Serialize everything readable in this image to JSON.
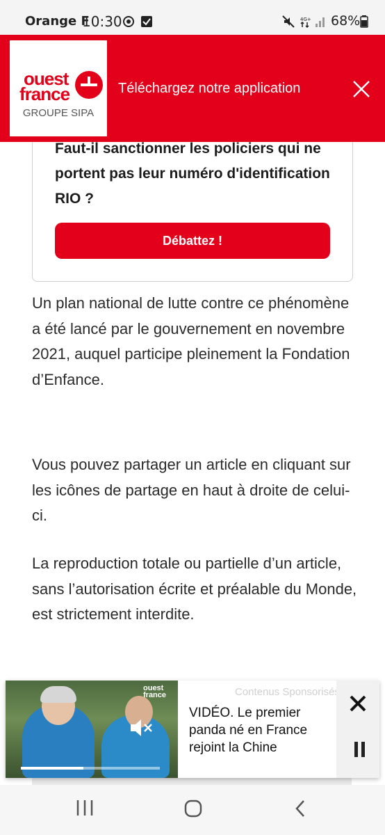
{
  "status_bar": {
    "carrier": "Orange F",
    "time": "10:30",
    "battery": "68%",
    "icons": [
      "notification-icon",
      "check-notification-icon",
      "mute-icon",
      "network-4g-icon",
      "signal-icon",
      "battery-icon"
    ]
  },
  "app_banner": {
    "logo_line1": "ouest",
    "logo_line2": "france",
    "logo_sub": "GROUPE SIPA",
    "text": "Téléchargez notre application",
    "close_icon": "close-icon",
    "color": "#e2001a"
  },
  "debate": {
    "question": "Faut-il sanctionner les policiers qui ne portent pas leur numéro d'identification RIO ?",
    "button_label": "Débattez !"
  },
  "article": {
    "paragraphs": [
      "Un plan national de lutte contre ce phénomène a été lancé par le gouvernement en novembre 2021, auquel participe pleinement la Fondation d’Enfance.",
      "Vous pouvez partager un article en cliquant sur les icônes de partage en haut à droite de celui-ci.",
      "La reproduction totale ou partielle d’un article, sans l’autorisation écrite et préalable du Monde, est strictement interdite."
    ]
  },
  "video_popup": {
    "label": "Contenus Sponsorisés",
    "title": "VIDÉO. Le premier panda né en France rejoint la Chine",
    "thumb_logo_line1": "ouest",
    "thumb_logo_line2": "france",
    "progress": 0.45,
    "mute_icon": "muted-speaker-icon",
    "close_icon": "close-icon",
    "pause_icon": "pause-icon"
  },
  "nav_bar": {
    "icons": [
      "recent-apps-icon",
      "home-icon",
      "back-icon"
    ]
  }
}
